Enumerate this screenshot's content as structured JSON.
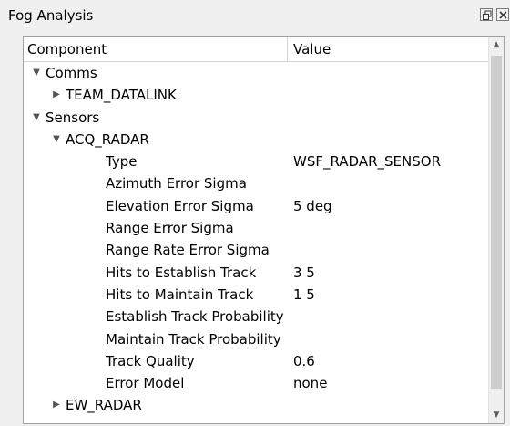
{
  "window": {
    "title": "Fog Analysis",
    "float_icon": "float-window-icon",
    "close_icon": "close-icon"
  },
  "tree": {
    "columns": {
      "component": "Component",
      "value": "Value"
    },
    "rows": [
      {
        "depth": 0,
        "arrow": "expanded",
        "component": "Comms",
        "value": ""
      },
      {
        "depth": 1,
        "arrow": "collapsed",
        "component": "TEAM_DATALINK",
        "value": ""
      },
      {
        "depth": 0,
        "arrow": "expanded",
        "component": "Sensors",
        "value": ""
      },
      {
        "depth": 1,
        "arrow": "expanded",
        "component": "ACQ_RADAR",
        "value": ""
      },
      {
        "depth": 2,
        "arrow": "none",
        "component": "Type",
        "value": "WSF_RADAR_SENSOR"
      },
      {
        "depth": 2,
        "arrow": "none",
        "component": "Azimuth Error Sigma",
        "value": ""
      },
      {
        "depth": 2,
        "arrow": "none",
        "component": "Elevation Error Sigma",
        "value": "5 deg"
      },
      {
        "depth": 2,
        "arrow": "none",
        "component": "Range Error Sigma",
        "value": ""
      },
      {
        "depth": 2,
        "arrow": "none",
        "component": "Range Rate Error Sigma",
        "value": ""
      },
      {
        "depth": 2,
        "arrow": "none",
        "component": "Hits to Establish Track",
        "value": "3 5"
      },
      {
        "depth": 2,
        "arrow": "none",
        "component": "Hits to Maintain Track",
        "value": "1 5"
      },
      {
        "depth": 2,
        "arrow": "none",
        "component": "Establish Track Probability",
        "value": ""
      },
      {
        "depth": 2,
        "arrow": "none",
        "component": "Maintain Track Probability",
        "value": ""
      },
      {
        "depth": 2,
        "arrow": "none",
        "component": "Track Quality",
        "value": "0.6"
      },
      {
        "depth": 2,
        "arrow": "none",
        "component": "Error Model",
        "value": "none"
      },
      {
        "depth": 1,
        "arrow": "collapsed",
        "component": "EW_RADAR",
        "value": ""
      }
    ],
    "scrollbar": {
      "up_icon": "scroll-up-arrow-icon",
      "down_icon": "scroll-down-arrow-icon",
      "visible_fraction": 0.9,
      "scroll_position": 0.0
    }
  },
  "colors": {
    "background": "#f0f0f0",
    "panel": "#ffffff",
    "border": "#a0a0a0",
    "text": "#000000",
    "arrow": "#555555",
    "scroll_thumb": "#cdcdcd"
  }
}
